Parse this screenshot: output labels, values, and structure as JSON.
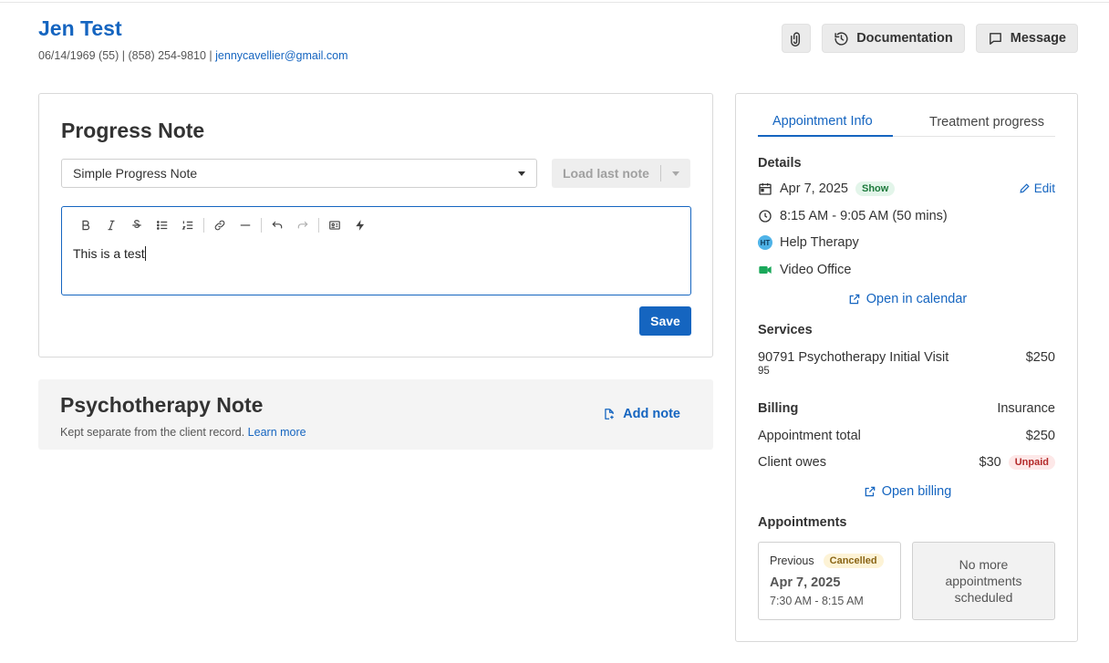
{
  "header": {
    "client_name": "Jen Test",
    "client_meta": "06/14/1969 (55) | (858) 254-9810 | ",
    "client_email": "jennycavellier@gmail.com",
    "documentation_label": "Documentation",
    "message_label": "Message"
  },
  "progress_note": {
    "title": "Progress Note",
    "template_value": "Simple Progress Note",
    "load_last_label": "Load last note",
    "editor_text": "This is a test",
    "save_label": "Save"
  },
  "psychotherapy_note": {
    "title": "Psychotherapy Note",
    "subtitle": "Kept separate from the client record.",
    "learn_more": "Learn more",
    "add_note_label": "Add note"
  },
  "right_panel": {
    "tabs": [
      "Appointment Info",
      "Treatment progress"
    ],
    "details": {
      "title": "Details",
      "date": "Apr 7, 2025",
      "status_badge": "Show",
      "edit_label": "Edit",
      "time": "8:15 AM - 9:05 AM (50 mins)",
      "clinician_initials": "HT",
      "clinician": "Help Therapy",
      "location": "Video Office",
      "open_calendar": "Open in calendar"
    },
    "services": {
      "title": "Services",
      "name": "90791 Psychotherapy Initial Visit",
      "sub": "95",
      "price": "$250"
    },
    "billing": {
      "title": "Billing",
      "type": "Insurance",
      "total_label": "Appointment total",
      "total_value": "$250",
      "owes_label": "Client owes",
      "owes_value": "$30",
      "owes_badge": "Unpaid",
      "open_billing": "Open billing"
    },
    "appointments": {
      "title": "Appointments",
      "previous_label": "Previous",
      "previous_badge": "Cancelled",
      "previous_date": "Apr 7, 2025",
      "previous_time": "7:30 AM - 8:15 AM",
      "none_text": "No more appointments scheduled"
    }
  },
  "colors": {
    "accent": "#1565c0",
    "badge_show": "#e3f5ea",
    "badge_unpaid": "#fde8e8",
    "badge_cancelled": "#fdf3d6",
    "video_icon": "#1aa85a"
  }
}
